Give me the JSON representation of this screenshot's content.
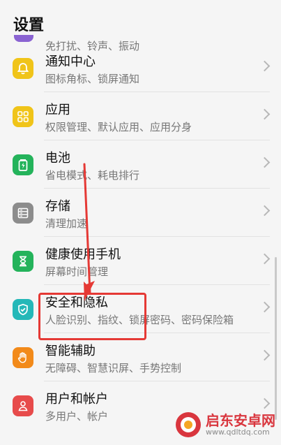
{
  "header": {
    "title": "设置"
  },
  "partial_row": {
    "subtitle": "免打扰、铃声、振动"
  },
  "rows": [
    {
      "title": "通知中心",
      "subtitle": "图标角标、锁屏通知",
      "icon": "bell-icon",
      "color": "#f0c419"
    },
    {
      "title": "应用",
      "subtitle": "权限管理、默认应用、应用分身",
      "icon": "apps-grid-icon",
      "color": "#f0c419"
    },
    {
      "title": "电池",
      "subtitle": "省电模式、耗电排行",
      "icon": "battery-icon",
      "color": "#24b35b"
    },
    {
      "title": "存储",
      "subtitle": "清理加速",
      "icon": "storage-icon",
      "color": "#8c8c8c"
    },
    {
      "title": "健康使用手机",
      "subtitle": "屏幕时间管理",
      "icon": "hourglass-icon",
      "color": "#24b35b"
    },
    {
      "title": "安全和隐私",
      "subtitle": "人脸识别、指纹、锁屏密码、密码保险箱",
      "icon": "shield-check-icon",
      "color": "#25b8b8"
    },
    {
      "title": "智能辅助",
      "subtitle": "无障碍、智慧识屏、手势控制",
      "icon": "hand-icon",
      "color": "#f28a1a"
    },
    {
      "title": "用户和帐户",
      "subtitle": "多用户、帐户",
      "icon": "user-icon",
      "color": "#e74b4b"
    }
  ],
  "watermark": {
    "text": "启东安卓网",
    "url": "www.qdltdq.com",
    "color": "#d9363e"
  },
  "annotation": {
    "color": "#e53935"
  }
}
